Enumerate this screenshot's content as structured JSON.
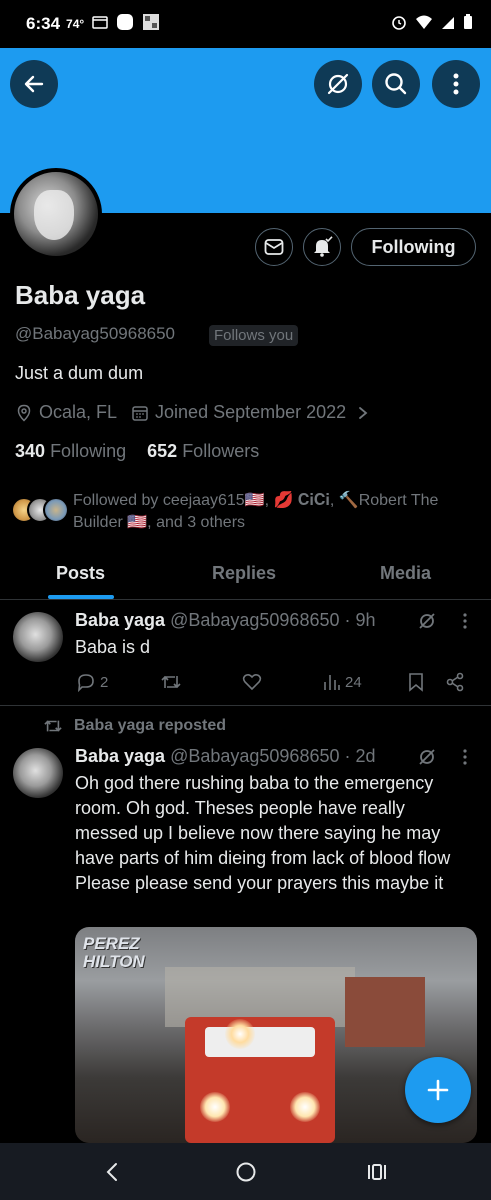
{
  "status_bar": {
    "time": "6:34",
    "temp": "74°"
  },
  "colors": {
    "accent": "#1d9bf0",
    "text": "#e7e9ea",
    "muted": "#71767b",
    "border": "#2f3336"
  },
  "header": {
    "back_icon": "arrow-left-icon",
    "grok_icon": "grok-icon",
    "search_icon": "search-icon",
    "more_icon": "more-vertical-icon"
  },
  "profile": {
    "follow_button": "Following",
    "name": "Baba yaga",
    "handle": "@Babayag50968650",
    "follows_you": "Follows you",
    "bio": "Just a dum dum",
    "location": "Ocala, FL",
    "joined": "Joined September 2022",
    "following_count": "340",
    "following_label": "Following",
    "followers_count": "652",
    "followers_label": "Followers",
    "followed_by_line1": "Followed by ceejaay615🇺🇸, 💋 𝐂𝐢𝐂𝐢, 🔨Robert The",
    "followed_by_line2": "Builder 🇺🇸, and 3 others"
  },
  "tabs": [
    {
      "label": "Posts",
      "active": true
    },
    {
      "label": "Replies",
      "active": false
    },
    {
      "label": "Media",
      "active": false
    }
  ],
  "posts": [
    {
      "name": "Baba yaga",
      "handle": "@Babayag50968650 · 9h",
      "text": "Baba is d",
      "replies": "2",
      "views": "24"
    },
    {
      "repost_label": "Baba yaga reposted",
      "name": "Baba yaga",
      "handle": "@Babayag50968650 · 2d",
      "text": "Oh god there rushing baba to the emergency room.    Oh god.   Theses people have really messed up I believe  now there saying he may have parts of him dieing from lack of blood flow    Please please send your prayers this maybe it",
      "media_caption": "PEREZ HILTON"
    }
  ]
}
